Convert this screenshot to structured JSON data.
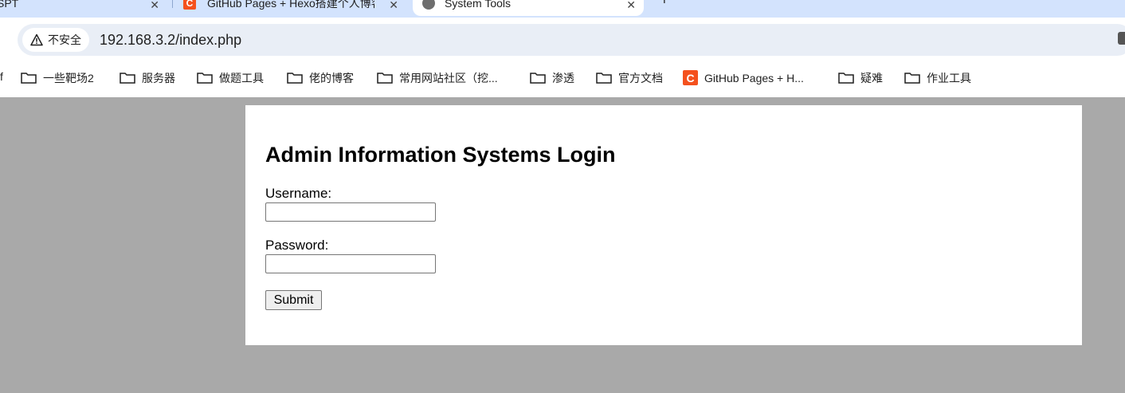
{
  "tabs": [
    {
      "title": "SPT",
      "active": false,
      "close": "✕"
    },
    {
      "title": "GitHub Pages + Hexo搭建个人博客",
      "active": false,
      "close": "✕"
    },
    {
      "title": "System Tools",
      "active": true,
      "close": "✕"
    }
  ],
  "new_tab_label": "+",
  "address_bar": {
    "security_label": "不安全",
    "url": "192.168.3.2/index.php"
  },
  "bookmarks": {
    "partial": "f",
    "items": [
      {
        "label": "一些靶场2",
        "icon": "folder-icon"
      },
      {
        "label": "服务器",
        "icon": "folder-icon"
      },
      {
        "label": "做题工具",
        "icon": "folder-icon"
      },
      {
        "label": "佬的博客",
        "icon": "folder-icon"
      },
      {
        "label": "常用网站社区（挖...",
        "icon": "folder-icon"
      },
      {
        "label": "渗透",
        "icon": "folder-icon"
      },
      {
        "label": "官方文档",
        "icon": "folder-icon"
      },
      {
        "label": "GitHub Pages + H...",
        "icon": "csdn-favicon-icon",
        "favicon_letter": "C"
      },
      {
        "label": "疑难",
        "icon": "folder-icon"
      },
      {
        "label": "作业工具",
        "icon": "folder-icon"
      }
    ]
  },
  "page": {
    "heading": "Admin Information Systems Login",
    "username_label": "Username:",
    "username_value": "",
    "password_label": "Password:",
    "password_value": "",
    "submit_label": "Submit"
  },
  "colors": {
    "tab_strip": "#d3e3fd",
    "omnibox": "#e9eef6",
    "page_bg": "#a9a9a9",
    "favicon_accent": "#f4511e"
  }
}
